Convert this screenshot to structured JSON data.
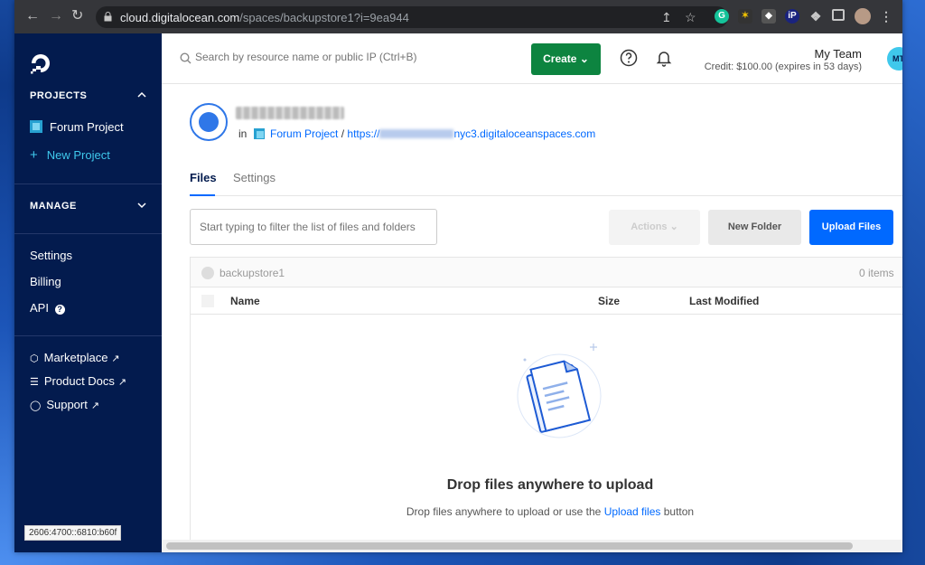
{
  "browser": {
    "url_host": "cloud.digitalocean.com",
    "url_path": "/spaces/backupstore1?i=9ea944",
    "ext_ip_label": "iP"
  },
  "sidebar": {
    "projects_header": "PROJECTS",
    "project_items": [
      {
        "label": "Forum Project"
      },
      {
        "label": "New Project"
      }
    ],
    "manage_header": "MANAGE",
    "manage_items": [
      {
        "label": "Settings"
      },
      {
        "label": "Billing"
      },
      {
        "label": "API"
      }
    ],
    "external_items": [
      {
        "label": "Marketplace"
      },
      {
        "label": "Product Docs"
      },
      {
        "label": "Support"
      }
    ]
  },
  "topbar": {
    "search_placeholder": "Search by resource name or public IP (Ctrl+B)",
    "create_label": "Create",
    "team_name": "My Team",
    "credit": "Credit: $100.00 (expires in 53 days)",
    "avatar_initials": "MT"
  },
  "space": {
    "in_label": "in",
    "project_link": "Forum Project",
    "separator": "/",
    "url_prefix": "https://",
    "url_suffix": "nyc3.digitaloceanspaces.com"
  },
  "tabs": [
    {
      "label": "Files"
    },
    {
      "label": "Settings"
    }
  ],
  "toolbar": {
    "filter_placeholder": "Start typing to filter the list of files and folders",
    "actions_label": "Actions",
    "new_folder_label": "New Folder",
    "upload_label": "Upload Files"
  },
  "table": {
    "path": "backupstore1",
    "count": "0 items",
    "columns": [
      "Name",
      "Size",
      "Last Modified"
    ]
  },
  "empty": {
    "title": "Drop files anywhere to upload",
    "subtitle_before": "Drop files anywhere to upload or use the ",
    "subtitle_link": "Upload files",
    "subtitle_after": " button"
  },
  "status_tip": "2606:4700::6810:b60f",
  "colors": {
    "sidebar_bg": "#031b4e",
    "accent_blue": "#0069ff",
    "create_green": "#0d8440",
    "new_project_cyan": "#3fc8ec"
  }
}
